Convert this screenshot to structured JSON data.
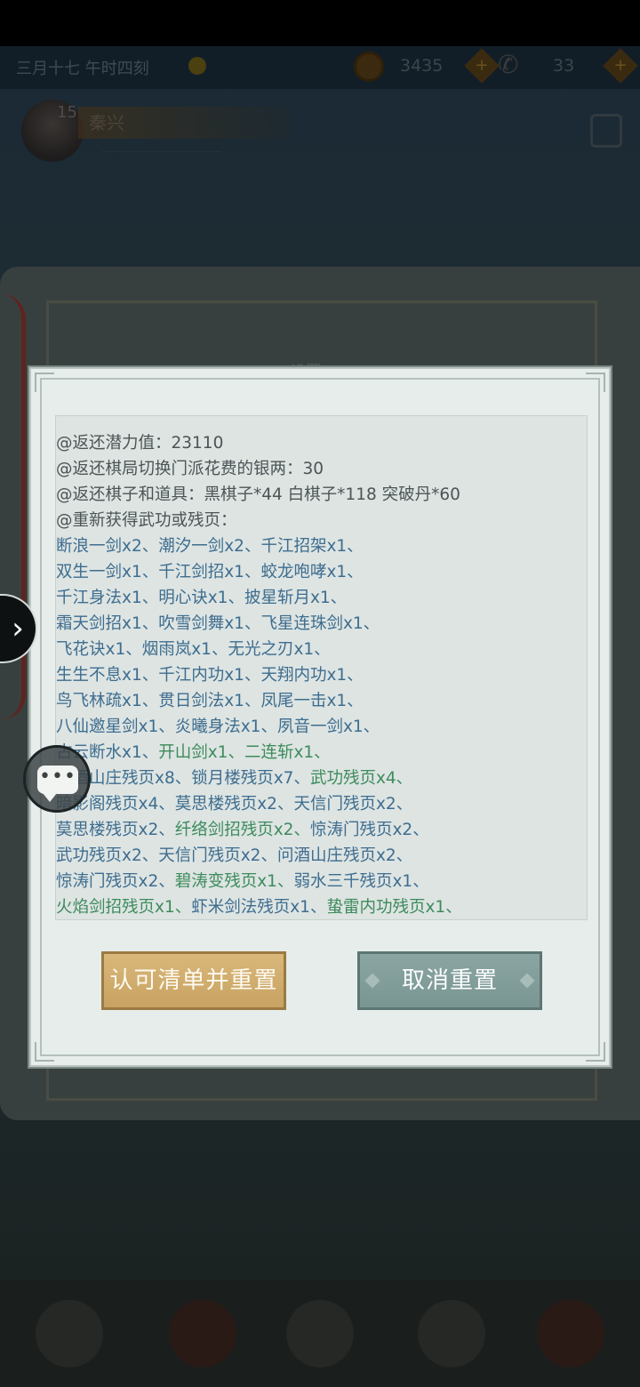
{
  "top_bar": {
    "date": "三月十七 午时四刻",
    "coins": "3435",
    "tickets": "33",
    "plus_label": "+"
  },
  "player": {
    "level": "15",
    "name": "秦兴",
    "subtitle": "一一一一一一一一一一一一一一一"
  },
  "book": {
    "tab_label": "设置"
  },
  "modal": {
    "lines": [
      [
        {
          "t": "@返还潜力值：23110",
          "c": "grey"
        }
      ],
      [
        {
          "t": "@返还棋局切换门派花费的银两：30",
          "c": "grey"
        }
      ],
      [
        {
          "t": "@返还棋子和道具：黑棋子*44 白棋子*118 突破丹*60",
          "c": "grey"
        }
      ],
      [
        {
          "t": "@重新获得武功或残页：",
          "c": "grey"
        }
      ],
      [
        {
          "t": "断浪一剑x2、潮汐一剑x2、千江招架x1、",
          "c": "blue"
        }
      ],
      [
        {
          "t": "双生一剑x1、千江剑招x1、蛟龙咆哮x1、",
          "c": "blue"
        }
      ],
      [
        {
          "t": "千江身法x1、明心诀x1、披星斩月x1、",
          "c": "blue"
        }
      ],
      [
        {
          "t": "霜天剑招x1、吹雪剑舞x1、飞星连珠剑x1、",
          "c": "blue"
        }
      ],
      [
        {
          "t": "飞花诀x1、烟雨岚x1、无光之刃x1、",
          "c": "blue"
        }
      ],
      [
        {
          "t": "生生不息x1、千江内功x1、天翔内功x1、",
          "c": "blue"
        }
      ],
      [
        {
          "t": "鸟飞林疏x1、贯日剑法x1、凤尾一击x1、",
          "c": "blue"
        }
      ],
      [
        {
          "t": "八仙邀星剑x1、炎曦身法x1、夙音一剑x1、",
          "c": "blue"
        }
      ],
      [
        {
          "t": "古云断水x1、",
          "c": "blue"
        },
        {
          "t": "开山剑x1、二连斩x1、",
          "c": "green"
        }
      ],
      [
        {
          "t": "问酒山庄残页x8、锁月楼残页x7、",
          "c": "blue"
        },
        {
          "t": "武功残页x4、",
          "c": "green"
        }
      ],
      [
        {
          "t": "暗影阁残页x4、莫思楼残页x2、天信门残页x2、",
          "c": "blue"
        }
      ],
      [
        {
          "t": "莫思楼残页x2、",
          "c": "blue"
        },
        {
          "t": "纤络剑招残页x2、",
          "c": "green"
        },
        {
          "t": "惊涛门残页x2、",
          "c": "blue"
        }
      ],
      [
        {
          "t": "武功残页x2、天信门残页x2、问酒山庄残页x2、",
          "c": "blue"
        }
      ],
      [
        {
          "t": "惊涛门残页x2、",
          "c": "blue"
        },
        {
          "t": "碧涛变残页x1、",
          "c": "green"
        },
        {
          "t": "弱水三千残页x1、",
          "c": "blue"
        }
      ],
      [
        {
          "t": "火焰剑招残页x1、",
          "c": "green"
        },
        {
          "t": "虾米剑法残页x1、",
          "c": "blue"
        },
        {
          "t": "蛰雷内功残页x1、",
          "c": "green"
        }
      ]
    ],
    "confirm_label": "认可清单并重置",
    "cancel_label": "取消重置"
  },
  "colors": {
    "skill_blue": "#3e6d8f",
    "page_green": "#3d8b5c",
    "confirm_gold": "#d1ad6e",
    "cancel_teal": "#829e9b"
  },
  "icons": {
    "nav": "chevron-right-icon",
    "chat": "chat-bubble-icon",
    "currency": "coin-icon"
  }
}
